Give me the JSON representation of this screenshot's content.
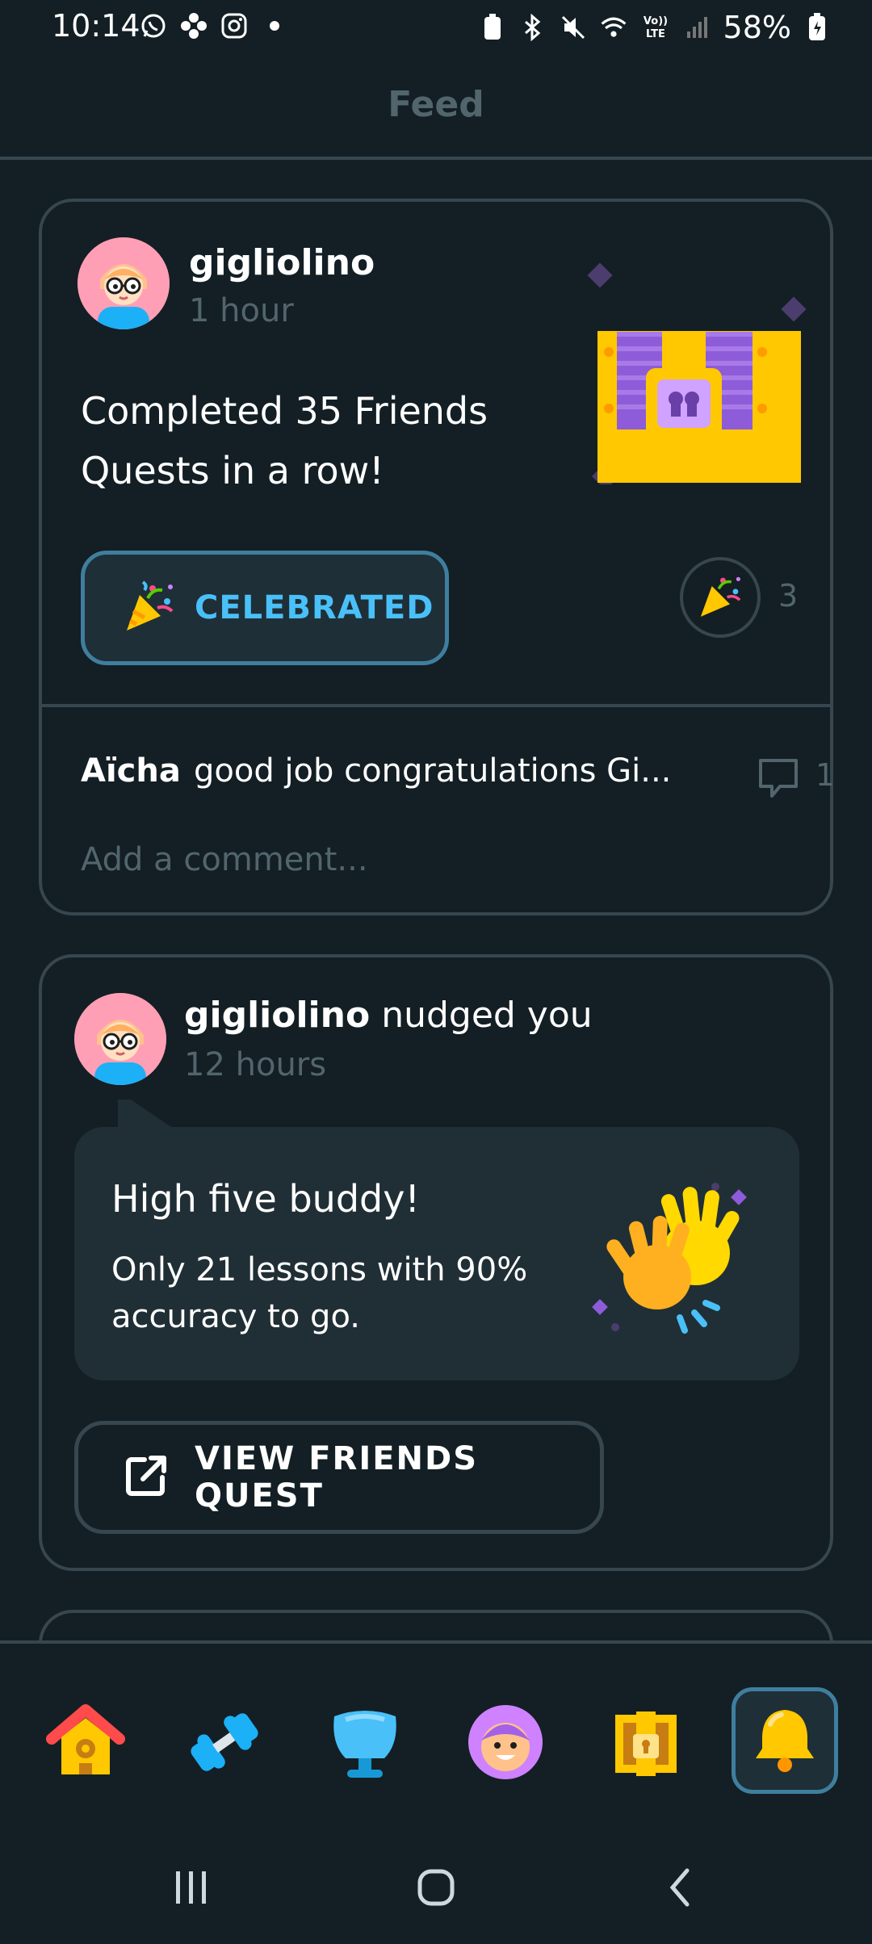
{
  "status_bar": {
    "time": "10:14",
    "battery": "58%"
  },
  "header": {
    "title": "Feed"
  },
  "post1": {
    "username": "gigliolino",
    "time": "1 hour",
    "message_line1": "Completed 35 Friends",
    "message_line2": "Quests in a row!",
    "celebrate_label": "CELEBRATED",
    "reaction_count": "3",
    "comment_author": "Aïcha",
    "comment_text": "good job congratulations Gi...",
    "comment_count": "1",
    "add_comment_placeholder": "Add a comment..."
  },
  "post2": {
    "username": "gigliolino",
    "action": "nudged you",
    "time": "12 hours",
    "bubble_title": "High five buddy!",
    "bubble_body": "Only 21 lessons with 90% accuracy to go.",
    "button_label": "VIEW FRIENDS QUEST"
  },
  "tabs": [
    {
      "icon": "home-icon"
    },
    {
      "icon": "dumbbell-icon"
    },
    {
      "icon": "league-shield-icon"
    },
    {
      "icon": "profile-icon"
    },
    {
      "icon": "chest-icon"
    },
    {
      "icon": "bell-icon",
      "active": true
    }
  ],
  "colors": {
    "background": "#131f24",
    "border": "#37464f",
    "accent_blue": "#49c0f8",
    "muted": "#52656d"
  }
}
